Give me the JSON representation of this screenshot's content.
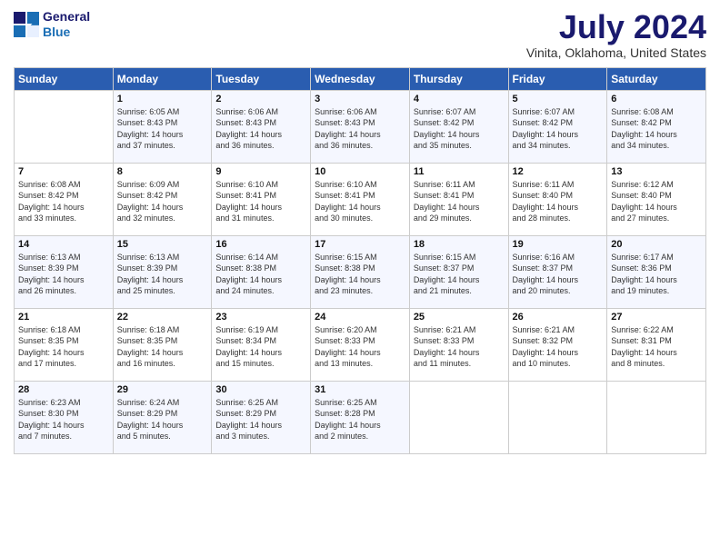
{
  "header": {
    "logo_line1": "General",
    "logo_line2": "Blue",
    "month": "July 2024",
    "location": "Vinita, Oklahoma, United States"
  },
  "days_of_week": [
    "Sunday",
    "Monday",
    "Tuesday",
    "Wednesday",
    "Thursday",
    "Friday",
    "Saturday"
  ],
  "weeks": [
    [
      {
        "day": "",
        "info": ""
      },
      {
        "day": "1",
        "info": "Sunrise: 6:05 AM\nSunset: 8:43 PM\nDaylight: 14 hours\nand 37 minutes."
      },
      {
        "day": "2",
        "info": "Sunrise: 6:06 AM\nSunset: 8:43 PM\nDaylight: 14 hours\nand 36 minutes."
      },
      {
        "day": "3",
        "info": "Sunrise: 6:06 AM\nSunset: 8:43 PM\nDaylight: 14 hours\nand 36 minutes."
      },
      {
        "day": "4",
        "info": "Sunrise: 6:07 AM\nSunset: 8:42 PM\nDaylight: 14 hours\nand 35 minutes."
      },
      {
        "day": "5",
        "info": "Sunrise: 6:07 AM\nSunset: 8:42 PM\nDaylight: 14 hours\nand 34 minutes."
      },
      {
        "day": "6",
        "info": "Sunrise: 6:08 AM\nSunset: 8:42 PM\nDaylight: 14 hours\nand 34 minutes."
      }
    ],
    [
      {
        "day": "7",
        "info": "Sunrise: 6:08 AM\nSunset: 8:42 PM\nDaylight: 14 hours\nand 33 minutes."
      },
      {
        "day": "8",
        "info": "Sunrise: 6:09 AM\nSunset: 8:42 PM\nDaylight: 14 hours\nand 32 minutes."
      },
      {
        "day": "9",
        "info": "Sunrise: 6:10 AM\nSunset: 8:41 PM\nDaylight: 14 hours\nand 31 minutes."
      },
      {
        "day": "10",
        "info": "Sunrise: 6:10 AM\nSunset: 8:41 PM\nDaylight: 14 hours\nand 30 minutes."
      },
      {
        "day": "11",
        "info": "Sunrise: 6:11 AM\nSunset: 8:41 PM\nDaylight: 14 hours\nand 29 minutes."
      },
      {
        "day": "12",
        "info": "Sunrise: 6:11 AM\nSunset: 8:40 PM\nDaylight: 14 hours\nand 28 minutes."
      },
      {
        "day": "13",
        "info": "Sunrise: 6:12 AM\nSunset: 8:40 PM\nDaylight: 14 hours\nand 27 minutes."
      }
    ],
    [
      {
        "day": "14",
        "info": "Sunrise: 6:13 AM\nSunset: 8:39 PM\nDaylight: 14 hours\nand 26 minutes."
      },
      {
        "day": "15",
        "info": "Sunrise: 6:13 AM\nSunset: 8:39 PM\nDaylight: 14 hours\nand 25 minutes."
      },
      {
        "day": "16",
        "info": "Sunrise: 6:14 AM\nSunset: 8:38 PM\nDaylight: 14 hours\nand 24 minutes."
      },
      {
        "day": "17",
        "info": "Sunrise: 6:15 AM\nSunset: 8:38 PM\nDaylight: 14 hours\nand 23 minutes."
      },
      {
        "day": "18",
        "info": "Sunrise: 6:15 AM\nSunset: 8:37 PM\nDaylight: 14 hours\nand 21 minutes."
      },
      {
        "day": "19",
        "info": "Sunrise: 6:16 AM\nSunset: 8:37 PM\nDaylight: 14 hours\nand 20 minutes."
      },
      {
        "day": "20",
        "info": "Sunrise: 6:17 AM\nSunset: 8:36 PM\nDaylight: 14 hours\nand 19 minutes."
      }
    ],
    [
      {
        "day": "21",
        "info": "Sunrise: 6:18 AM\nSunset: 8:35 PM\nDaylight: 14 hours\nand 17 minutes."
      },
      {
        "day": "22",
        "info": "Sunrise: 6:18 AM\nSunset: 8:35 PM\nDaylight: 14 hours\nand 16 minutes."
      },
      {
        "day": "23",
        "info": "Sunrise: 6:19 AM\nSunset: 8:34 PM\nDaylight: 14 hours\nand 15 minutes."
      },
      {
        "day": "24",
        "info": "Sunrise: 6:20 AM\nSunset: 8:33 PM\nDaylight: 14 hours\nand 13 minutes."
      },
      {
        "day": "25",
        "info": "Sunrise: 6:21 AM\nSunset: 8:33 PM\nDaylight: 14 hours\nand 11 minutes."
      },
      {
        "day": "26",
        "info": "Sunrise: 6:21 AM\nSunset: 8:32 PM\nDaylight: 14 hours\nand 10 minutes."
      },
      {
        "day": "27",
        "info": "Sunrise: 6:22 AM\nSunset: 8:31 PM\nDaylight: 14 hours\nand 8 minutes."
      }
    ],
    [
      {
        "day": "28",
        "info": "Sunrise: 6:23 AM\nSunset: 8:30 PM\nDaylight: 14 hours\nand 7 minutes."
      },
      {
        "day": "29",
        "info": "Sunrise: 6:24 AM\nSunset: 8:29 PM\nDaylight: 14 hours\nand 5 minutes."
      },
      {
        "day": "30",
        "info": "Sunrise: 6:25 AM\nSunset: 8:29 PM\nDaylight: 14 hours\nand 3 minutes."
      },
      {
        "day": "31",
        "info": "Sunrise: 6:25 AM\nSunset: 8:28 PM\nDaylight: 14 hours\nand 2 minutes."
      },
      {
        "day": "",
        "info": ""
      },
      {
        "day": "",
        "info": ""
      },
      {
        "day": "",
        "info": ""
      }
    ]
  ]
}
